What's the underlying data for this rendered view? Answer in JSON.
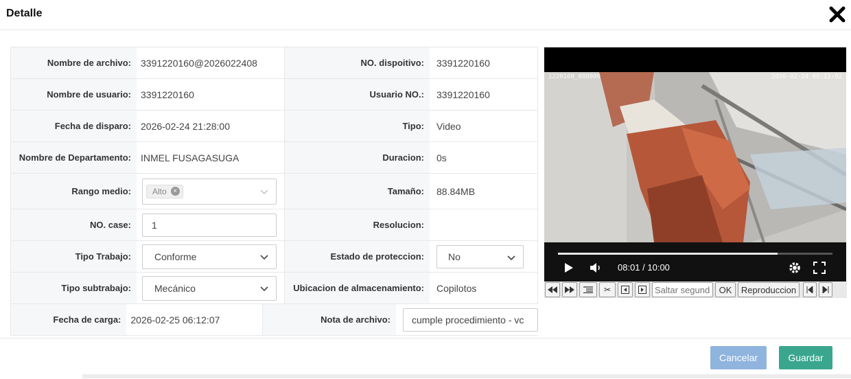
{
  "dialog": {
    "title": "Detalle"
  },
  "fields": {
    "nombre_archivo": {
      "label": "Nombre de archivo:",
      "value": "3391220160@2026022408"
    },
    "no_dispositivo": {
      "label": "NO. dispoitivo:",
      "value": "3391220160"
    },
    "nombre_usuario": {
      "label": "Nombre de usuario:",
      "value": "3391220160"
    },
    "usuario_no": {
      "label": "Usuario NO.:",
      "value": "3391220160"
    },
    "fecha_disparo": {
      "label": "Fecha de disparo:",
      "value": "2026-02-24 21:28:00"
    },
    "tipo": {
      "label": "Tipo:",
      "value": "Video"
    },
    "departamento": {
      "label": "Nombre de Departamento:",
      "value": "INMEL FUSAGASUGA"
    },
    "duracion": {
      "label": "Duracion:",
      "value": "0s"
    },
    "rango_medio": {
      "label": "Rango medio:",
      "tag": "Alto"
    },
    "tamano": {
      "label": "Tamaño:",
      "value": "88.84MB"
    },
    "no_case": {
      "label": "NO. case:",
      "value": "1"
    },
    "resolucion": {
      "label": "Resolucion:",
      "value": ""
    },
    "tipo_trabajo": {
      "label": "Tipo Trabajo:",
      "value": "Conforme"
    },
    "estado_proteccion": {
      "label": "Estado de proteccion:",
      "value": "No"
    },
    "tipo_subtrabajo": {
      "label": "Tipo subtrabajo:",
      "value": "Mecánico"
    },
    "ubicacion": {
      "label": "Ubicacion de almacenamiento:",
      "value": "Copilotos"
    },
    "fecha_carga": {
      "label": "Fecha de carga:",
      "value": "2026-02-25 06:12:07"
    },
    "nota_archivo": {
      "label": "Nota de archivo:",
      "value": "cumple procedimiento - vc"
    }
  },
  "player": {
    "osd_left": "1220160_000000",
    "osd_right": "2026-02-24 08:21:02",
    "timecode": "08:01 / 10:00",
    "progress_fraction": 0.8,
    "toolbar": {
      "seek_placeholder": "Saltar segundo",
      "ok_label": "OK",
      "playback_label": "Reproduccion"
    }
  },
  "footer": {
    "cancel_label": "Cancelar",
    "save_label": "Guardar"
  },
  "colors": {
    "cancel": "#8fb4de",
    "save": "#3aa68e"
  },
  "icons": [
    "close-icon",
    "chevron-down-icon",
    "play-icon",
    "volume-icon",
    "settings-icon",
    "fullscreen-icon",
    "rewind-icon",
    "fast-forward-icon",
    "list-icon",
    "scissors-icon",
    "prev-frame-icon",
    "next-frame-icon",
    "skip-start-icon",
    "skip-end-icon"
  ]
}
